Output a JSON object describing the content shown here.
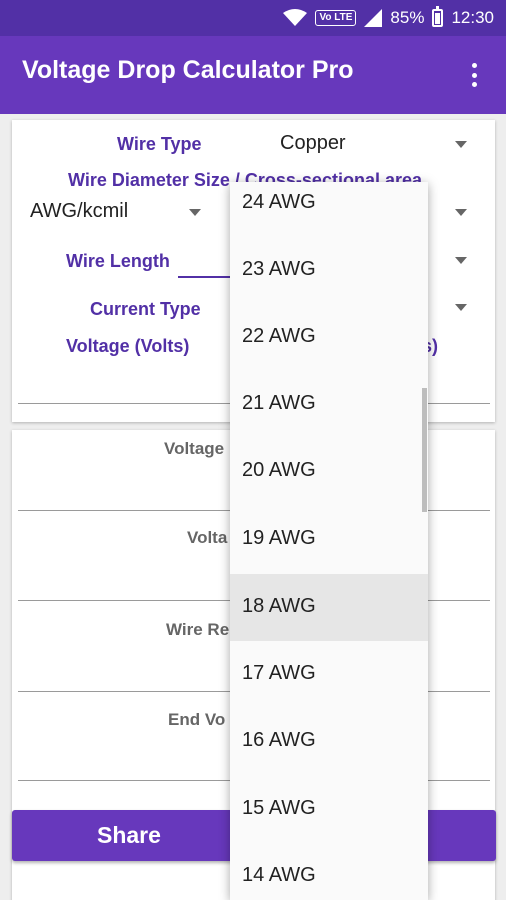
{
  "status_bar": {
    "volte": "Vo LTE",
    "battery_pct": "85%",
    "time": "12:30"
  },
  "app_bar": {
    "title": "Voltage Drop Calculator Pro"
  },
  "form": {
    "wire_type_label": "Wire Type",
    "wire_type_value": "Copper",
    "wire_size_label": "Wire Diameter Size / Cross-sectional area",
    "size_unit_value": "AWG/kcmil",
    "wire_length_label": "Wire Length",
    "current_type_label": "Current Type",
    "voltage_label": "Voltage (Volts)",
    "partial_right_label": "s)"
  },
  "results": {
    "voltage_drop_partial": "Voltage",
    "voltage_pct_partial": "Volta",
    "wire_resistance_partial": "Wire Re",
    "end_voltage_partial": "End Vo"
  },
  "share_button": "Share",
  "dropdown": {
    "items": [
      "24 AWG",
      "23 AWG",
      "22 AWG",
      "21 AWG",
      "20 AWG",
      "19 AWG",
      "18 AWG",
      "17 AWG",
      "16 AWG",
      "15 AWG",
      "14 AWG"
    ],
    "highlighted": "18 AWG"
  }
}
